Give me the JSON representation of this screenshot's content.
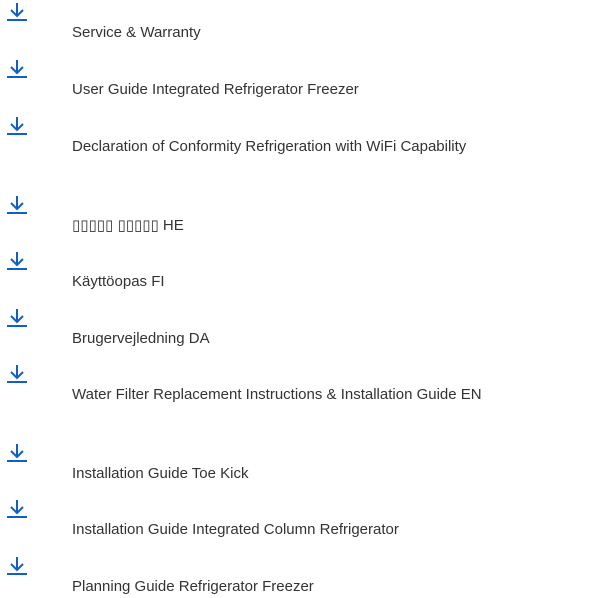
{
  "colors": {
    "icon": "#0f5fc6",
    "text": "#333333",
    "background": "#ffffff"
  },
  "icons": {
    "download": "download-arrow-icon"
  },
  "documents": [
    {
      "title": "Service & Warranty"
    },
    {
      "title": "User Guide Integrated Refrigerator Freezer"
    },
    {
      "title": "Declaration of Conformity Refrigeration with WiFi Capability"
    },
    {
      "title": "▯▯▯▯▯ ▯▯▯▯▯ HE"
    },
    {
      "title": "Käyttöopas FI"
    },
    {
      "title": "Brugervejledning DA"
    },
    {
      "title": "Water Filter Replacement Instructions & Installation Guide EN"
    },
    {
      "title": "Installation Guide Toe Kick"
    },
    {
      "title": "Installation Guide Integrated Column Refrigerator"
    },
    {
      "title": "Planning Guide Refrigerator Freezer"
    }
  ]
}
